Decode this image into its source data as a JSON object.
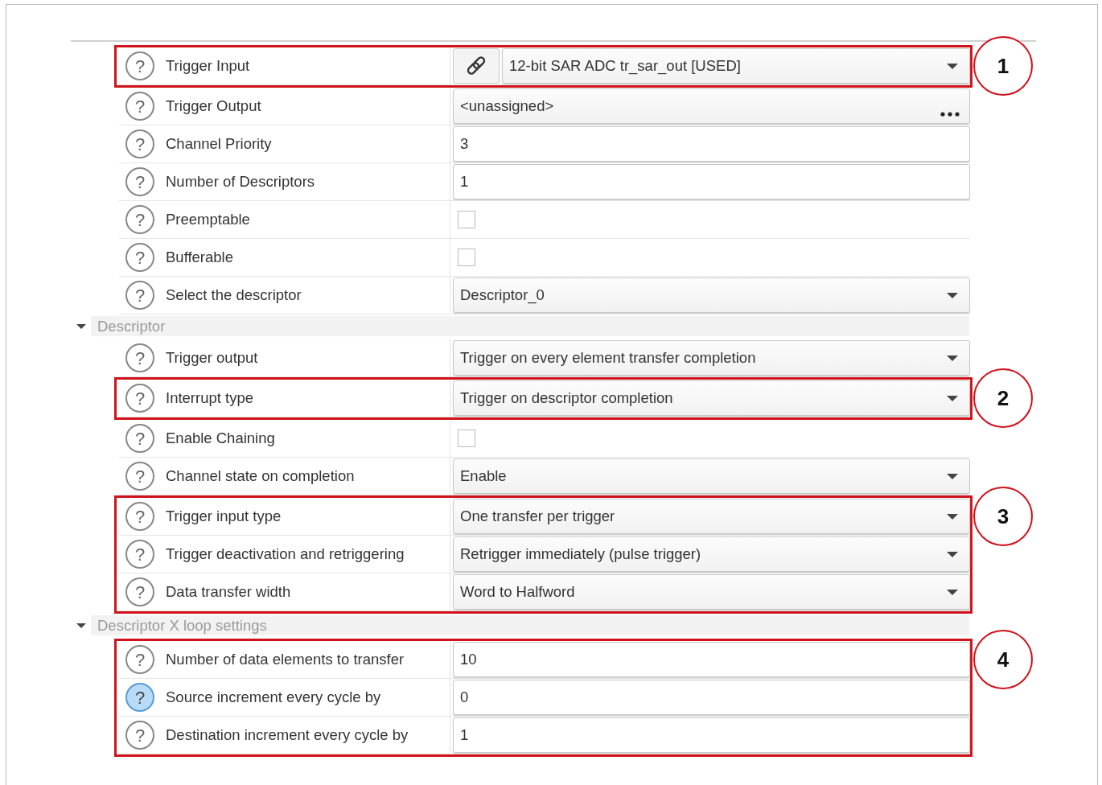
{
  "rows": [
    {
      "kind": "callout",
      "number": "1",
      "rows": [
        {
          "kind": "link_dropdown",
          "help": "?",
          "help_active": false,
          "label": "Trigger Input",
          "value": "12-bit SAR ADC tr_sar_out [USED]"
        }
      ]
    },
    {
      "kind": "browse",
      "help": "?",
      "help_active": false,
      "label": "Trigger Output",
      "value": "<unassigned>"
    },
    {
      "kind": "field",
      "help": "?",
      "help_active": false,
      "label": "Channel Priority",
      "value": "3"
    },
    {
      "kind": "field",
      "help": "?",
      "help_active": false,
      "label": "Number of Descriptors",
      "value": "1"
    },
    {
      "kind": "checkbox",
      "help": "?",
      "help_active": false,
      "label": "Preemptable",
      "checked": false
    },
    {
      "kind": "checkbox",
      "help": "?",
      "help_active": false,
      "label": "Bufferable",
      "checked": false
    },
    {
      "kind": "dropdown",
      "help": "?",
      "help_active": false,
      "label": "Select the descriptor",
      "value": "Descriptor_0"
    },
    {
      "kind": "section",
      "label": "Descriptor",
      "expanded": true
    },
    {
      "kind": "dropdown",
      "help": "?",
      "help_active": false,
      "label": "Trigger output",
      "value": "Trigger on every element transfer completion"
    },
    {
      "kind": "callout",
      "number": "2",
      "rows": [
        {
          "kind": "dropdown",
          "help": "?",
          "help_active": false,
          "label": "Interrupt type",
          "value": "Trigger on descriptor completion"
        }
      ]
    },
    {
      "kind": "checkbox",
      "help": "?",
      "help_active": false,
      "label": "Enable Chaining",
      "checked": false
    },
    {
      "kind": "dropdown",
      "help": "?",
      "help_active": false,
      "label": "Channel state on completion",
      "value": "Enable"
    },
    {
      "kind": "callout",
      "number": "3",
      "rows": [
        {
          "kind": "dropdown",
          "help": "?",
          "help_active": false,
          "label": "Trigger input type",
          "value": "One transfer per trigger"
        },
        {
          "kind": "dropdown",
          "help": "?",
          "help_active": false,
          "label": "Trigger deactivation and retriggering",
          "value": "Retrigger immediately (pulse trigger)"
        },
        {
          "kind": "dropdown",
          "help": "?",
          "help_active": false,
          "label": "Data transfer width",
          "value": "Word to Halfword"
        }
      ]
    },
    {
      "kind": "section",
      "label": "Descriptor X loop settings",
      "expanded": true
    },
    {
      "kind": "callout",
      "number": "4",
      "rows": [
        {
          "kind": "field",
          "help": "?",
          "help_active": false,
          "label": "Number of data elements to transfer",
          "value": "10"
        },
        {
          "kind": "field",
          "help": "?",
          "help_active": true,
          "label": "Source increment every cycle by",
          "value": "0"
        },
        {
          "kind": "field",
          "help": "?",
          "help_active": false,
          "label": "Destination increment every cycle by",
          "value": "1"
        }
      ]
    }
  ]
}
